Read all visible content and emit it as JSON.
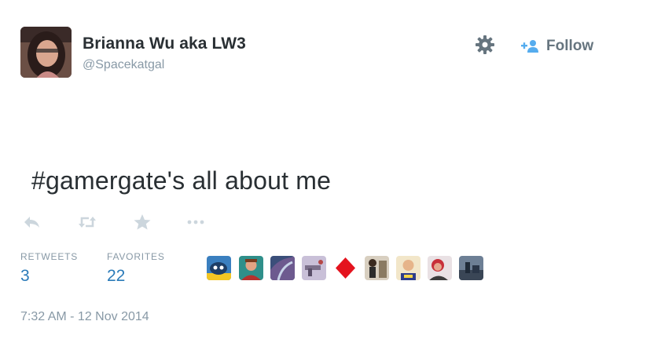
{
  "author": {
    "name": "Brianna Wu aka LW3",
    "handle": "@Spacekatgal"
  },
  "header_actions": {
    "settings_icon": "gear-icon",
    "follow_icon": "add-user-icon",
    "follow_label": "Follow"
  },
  "tweet": {
    "text": "#gamergate's all about me"
  },
  "actions": [
    "reply-icon",
    "retweet-icon",
    "favorite-icon",
    "more-icon"
  ],
  "stats": {
    "retweets_label": "RETWEETS",
    "retweets_count": "3",
    "favorites_label": "FAVORITES",
    "favorites_count": "22"
  },
  "favoriters": [
    {
      "icon": "favoriter-avatar-1",
      "bg": "#3a7fbf"
    },
    {
      "icon": "favoriter-avatar-2",
      "bg": "#2f8f8a"
    },
    {
      "icon": "favoriter-avatar-3",
      "bg": "#3b4f7a"
    },
    {
      "icon": "favoriter-avatar-4",
      "bg": "#c9c0d8"
    },
    {
      "icon": "favoriter-avatar-5",
      "bg": "#ffffff"
    },
    {
      "icon": "favoriter-avatar-6",
      "bg": "#d8cfc0"
    },
    {
      "icon": "favoriter-avatar-7",
      "bg": "#f2e6c9"
    },
    {
      "icon": "favoriter-avatar-8",
      "bg": "#e9e1e4"
    },
    {
      "icon": "favoriter-avatar-9",
      "bg": "#6d7f95"
    }
  ],
  "timestamp": "7:32 AM - 12 Nov 2014",
  "colors": {
    "text": "#292f33",
    "muted": "#8899a6",
    "link": "#2b7bb9",
    "icon": "#ccd6dd",
    "follow_text": "#66757f"
  }
}
